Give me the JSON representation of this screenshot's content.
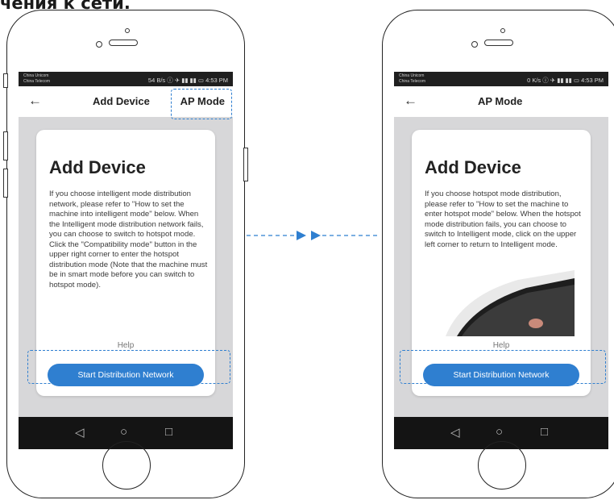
{
  "heading": "чения к сети.",
  "left_phone": {
    "status": {
      "carrier_line1": "China Unicom",
      "carrier_line2": "China Telecom",
      "right": "54 B/s ⓘ ✈ ▮▮ ▮▮ ▭ 4:53 PM"
    },
    "appbar": {
      "title": "Add Device",
      "ap_mode": "AP Mode"
    },
    "card": {
      "title": "Add Device",
      "body": "If you choose intelligent mode distribution network, please refer to \"How to set the machine into intelligent mode\" below. When the Intelligent mode distribution network fails, you can choose to switch to hotspot mode. Click the \"Compatibility mode\" button in the upper right corner to enter the hotspot distribution mode (Note that the machine must be in smart mode before you can switch to hotspot mode).",
      "help": "Help",
      "button": "Start Distribution Network"
    }
  },
  "right_phone": {
    "status": {
      "carrier_line1": "China Unicom",
      "carrier_line2": "China Telecom",
      "right": "0 K/s ⓘ ✈ ▮▮ ▮▮ ▭ 4:53 PM"
    },
    "appbar": {
      "title": "AP Mode"
    },
    "card": {
      "title": "Add Device",
      "body": "If you choose hotspot mode distribution, please refer to \"How to set the machine to enter hotspot mode\" below. When the hotspot mode distribution fails, you can choose to switch to Intelligent mode, click on the upper left corner to return to Intelligent mode.",
      "help": "Help",
      "button": "Start Distribution Network"
    }
  },
  "nav": {
    "back_icon": "◁",
    "home_icon": "○",
    "recent_icon": "□",
    "back_arrow": "←"
  },
  "colors": {
    "accent": "#2f7fd0",
    "screen_bg": "#d7d7d9",
    "bar_dark": "#141414"
  }
}
